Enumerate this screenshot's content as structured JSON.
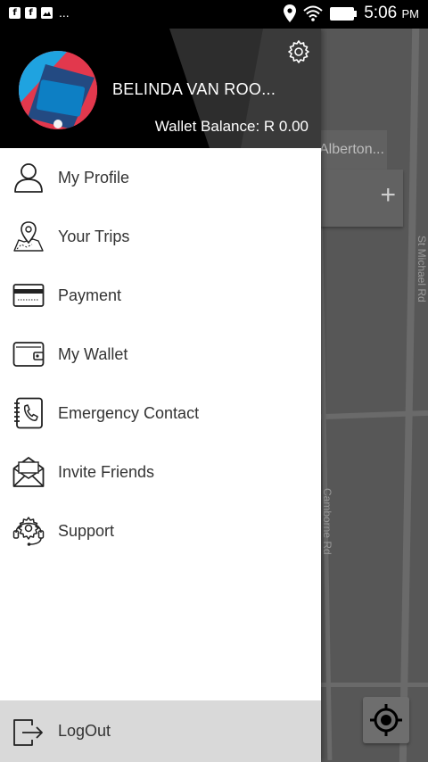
{
  "status_bar": {
    "notification_icons": [
      "facebook-icon",
      "facebook-icon",
      "image-icon"
    ],
    "overflow": "...",
    "time": "5:06",
    "ampm": "PM"
  },
  "map": {
    "place_label": "Alberton...",
    "street_1": "St Michael Rd",
    "street_2": "Camborne Rd",
    "plus_label": "+"
  },
  "drawer": {
    "user_name": "BELINDA VAN ROO...",
    "wallet_balance": "Wallet Balance: R 0.00",
    "menu": [
      {
        "label": "My Profile",
        "icon": "user-icon"
      },
      {
        "label": "Your Trips",
        "icon": "map-pin-icon"
      },
      {
        "label": "Payment",
        "icon": "credit-card-icon"
      },
      {
        "label": "My Wallet",
        "icon": "wallet-icon"
      },
      {
        "label": "Emergency Contact",
        "icon": "phone-book-icon"
      },
      {
        "label": "Invite Friends",
        "icon": "envelope-icon"
      },
      {
        "label": "Support",
        "icon": "headset-gear-icon"
      }
    ],
    "logout_label": "LogOut"
  },
  "colors": {
    "header_bg": "#000000",
    "header_accent": "#333333",
    "drawer_bg": "#ffffff",
    "logout_bg": "#d9d9d9",
    "map_bg": "#575757"
  }
}
